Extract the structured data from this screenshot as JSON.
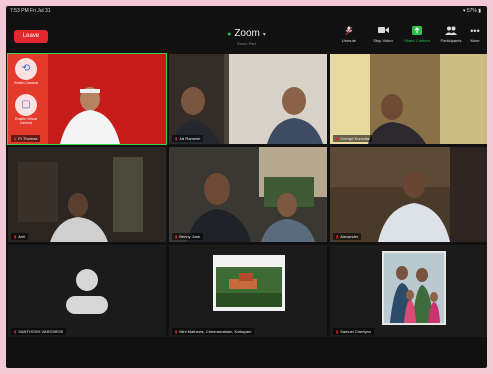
{
  "statusbar": {
    "time": "7:53 PM  Fri Jul 31",
    "battery": "▾ 57% ▮"
  },
  "topbar": {
    "leave_label": "Leave",
    "title": "Zoom",
    "subtitle": "Zoom Pad",
    "tools": [
      {
        "label": "Unmute",
        "icon": "mic-muted-icon",
        "glyph": "🎤"
      },
      {
        "label": "Stop Video",
        "icon": "video-icon",
        "glyph": "■"
      },
      {
        "label": "Share Content",
        "icon": "share-icon",
        "glyph": "↑"
      },
      {
        "label": "Participants",
        "icon": "participants-icon",
        "glyph": "👥"
      },
      {
        "label": "More",
        "icon": "more-icon",
        "glyph": "•••"
      }
    ]
  },
  "camera_controls": {
    "switch_label": "Switch Camera",
    "virtual_label": "Enable Virtual Camera"
  },
  "participants": [
    "Fr Thomas",
    "Jai Ramesh",
    "George Kuruvila",
    "Anil",
    "Benny Jose",
    "Alexander",
    "SANTHOSH VARGHESE",
    "Mini Mathews, Cheeramattam, Kottayam",
    "Samuel Cheriyan"
  ],
  "colors": {
    "leave": "#e0282e",
    "active_speaker": "#3bd24a",
    "accent": "#2fbf4b"
  }
}
